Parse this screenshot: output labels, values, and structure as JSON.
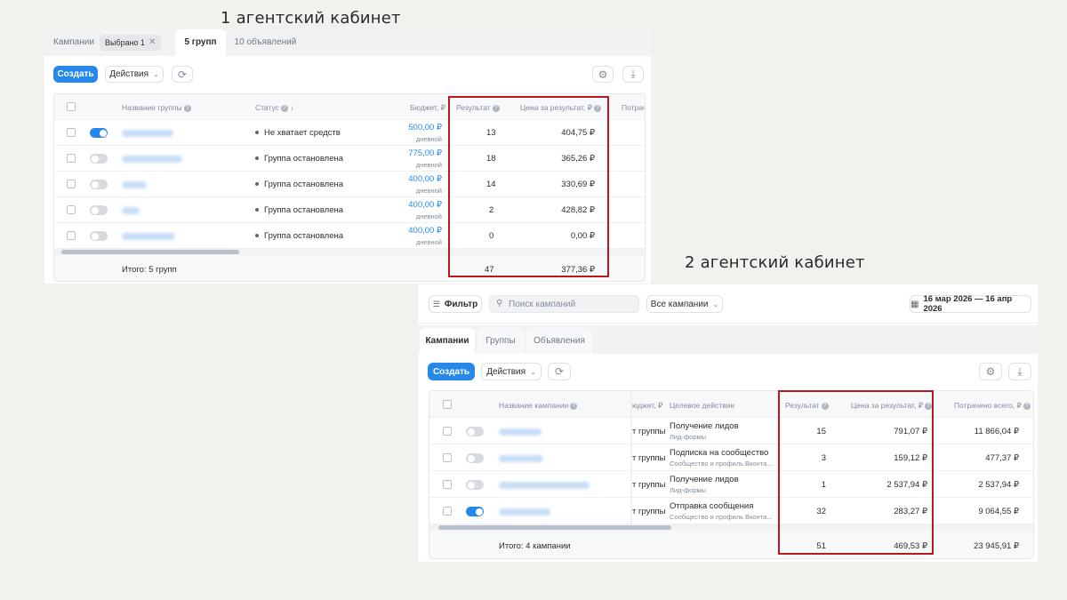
{
  "captions": {
    "cabinet1": "1 агентский кабинет",
    "cabinet2": "2 агентский кабинет"
  },
  "panel1": {
    "tabs": {
      "campaigns": "Кампании",
      "selected_chip": "Выбрано 1",
      "groups": "5 групп",
      "ads": "10 объявлений"
    },
    "toolbar": {
      "create": "Создать",
      "actions": "Действия"
    },
    "headers": {
      "name": "Название группы",
      "status": "Статус",
      "budget": "Бюджет, ₽",
      "result": "Результат",
      "price": "Цена за результат, ₽",
      "spent": "Потраче"
    },
    "rows": [
      {
        "status": "Не хватает средств",
        "budget": "500,00 ₽",
        "budget_type": "дневной",
        "result": "13",
        "price": "404,75 ₽",
        "toggle": "on"
      },
      {
        "status": "Группа остановлена",
        "budget": "775,00 ₽",
        "budget_type": "дневной",
        "result": "18",
        "price": "365,26 ₽",
        "toggle": "off"
      },
      {
        "status": "Группа остановлена",
        "budget": "400,00 ₽",
        "budget_type": "дневной",
        "result": "14",
        "price": "330,69 ₽",
        "toggle": "off"
      },
      {
        "status": "Группа остановлена",
        "budget": "400,00 ₽",
        "budget_type": "дневной",
        "result": "2",
        "price": "428,82 ₽",
        "toggle": "off"
      },
      {
        "status": "Группа остановлена",
        "budget": "400,00 ₽",
        "budget_type": "дневной",
        "result": "0",
        "price": "0,00 ₽",
        "toggle": "off"
      }
    ],
    "total": {
      "label": "Итого: 5 групп",
      "result": "47",
      "price": "377,36 ₽"
    }
  },
  "panel2": {
    "filter": "Фильтр",
    "search_placeholder": "Поиск кампаний",
    "all_campaigns": "Все кампании",
    "date_range": "16 мар 2026 — 16 апр 2026",
    "tabs": {
      "campaigns": "Кампании",
      "groups": "Группы",
      "ads": "Объявления"
    },
    "toolbar": {
      "create": "Создать",
      "actions": "Действия"
    },
    "headers": {
      "name": "Название кампании",
      "budget": "юджет, ₽",
      "target": "Целевое действие",
      "result": "Результат",
      "price": "Цена за результат, ₽",
      "spent": "Потрачено всего, ₽"
    },
    "rows": [
      {
        "budget": "т группы",
        "target": "Получение лидов",
        "target_sub": "Лид-формы",
        "result": "15",
        "price": "791,07 ₽",
        "spent": "11 866,04 ₽",
        "toggle": "off"
      },
      {
        "budget": "т группы",
        "target": "Подписка на сообщество",
        "target_sub": "Сообщество и профиль Вконта...",
        "result": "3",
        "price": "159,12 ₽",
        "spent": "477,37 ₽",
        "toggle": "off"
      },
      {
        "budget": "т группы",
        "target": "Получение лидов",
        "target_sub": "Лид-формы",
        "result": "1",
        "price": "2 537,94 ₽",
        "spent": "2 537,94 ₽",
        "toggle": "off"
      },
      {
        "budget": "т группы",
        "target": "Отправка сообщения",
        "target_sub": "Сообщество и профиль Вконта...",
        "result": "32",
        "price": "283,27 ₽",
        "spent": "9 064,55 ₽",
        "toggle": "on"
      }
    ],
    "total": {
      "label": "Итого: 4 кампании",
      "result": "51",
      "price": "469,53 ₽",
      "spent": "23 945,91 ₽"
    }
  },
  "colors": {
    "accent": "#2688eb",
    "highlight_box": "#b7191e"
  }
}
